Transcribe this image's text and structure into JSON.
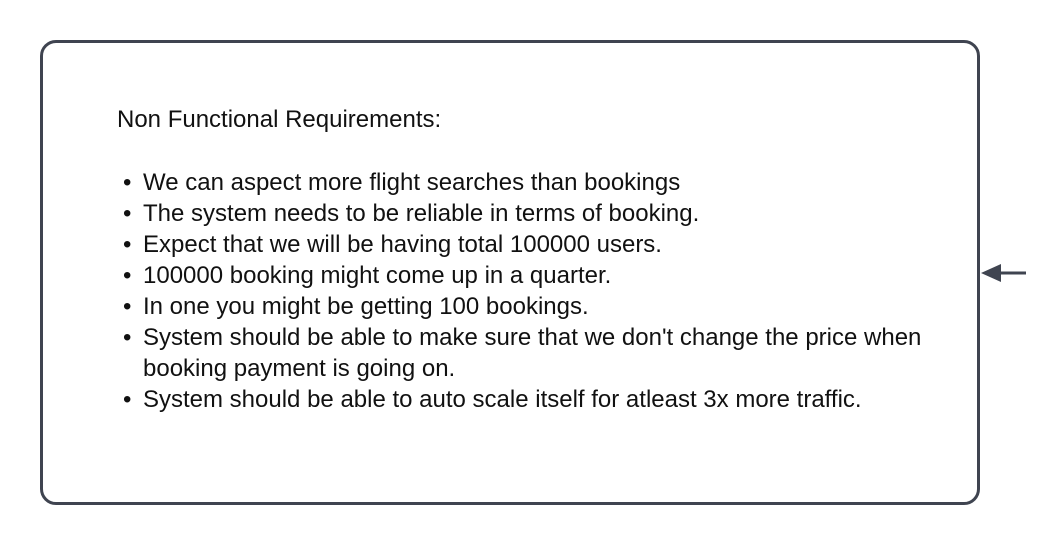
{
  "colors": {
    "border": "#3f4450",
    "text": "#111111",
    "connector": "#3f4450"
  },
  "card": {
    "title": "Non Functional Requirements:",
    "bullet_glyph": "•",
    "items": [
      "We can aspect more flight searches than bookings",
      "The system needs to be reliable in terms of booking.",
      "Expect that we will be having total 100000 users.",
      "100000 booking might come up in a quarter.",
      "In one you might be getting 100 bookings.",
      "System should be able to make sure that we don't change the price when booking payment is going on.",
      "System should be able to auto scale itself for atleast 3x more traffic."
    ]
  },
  "connector": {
    "icon": "arrow-left-icon"
  }
}
